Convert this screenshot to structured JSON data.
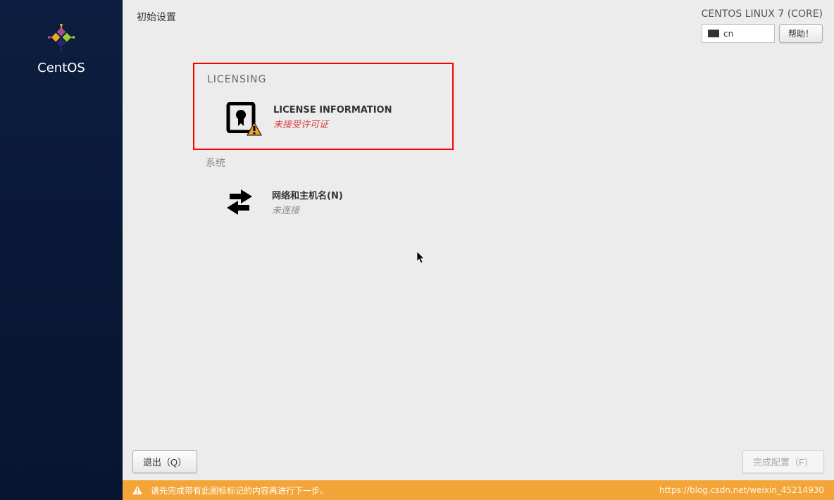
{
  "sidebar": {
    "brand": "CentOS"
  },
  "header": {
    "title": "初始设置",
    "distro": "CENTOS LINUX 7 (CORE)",
    "keyboard_lang": "cn",
    "help_label": "帮助！"
  },
  "licensing": {
    "section_title": "LICENSING",
    "item_title": "LICENSE INFORMATION",
    "item_status": "未接受许可证"
  },
  "system": {
    "section_title": "系统",
    "network_title": "网络和主机名(N)",
    "network_status": "未连接"
  },
  "footer": {
    "quit_label": "退出（Q）",
    "finish_label": "完成配置（F）"
  },
  "warning": {
    "message": "请先完成带有此图标标记的内容再进行下一步。"
  },
  "watermark": "https://blog.csdn.net/weixin_45214930"
}
